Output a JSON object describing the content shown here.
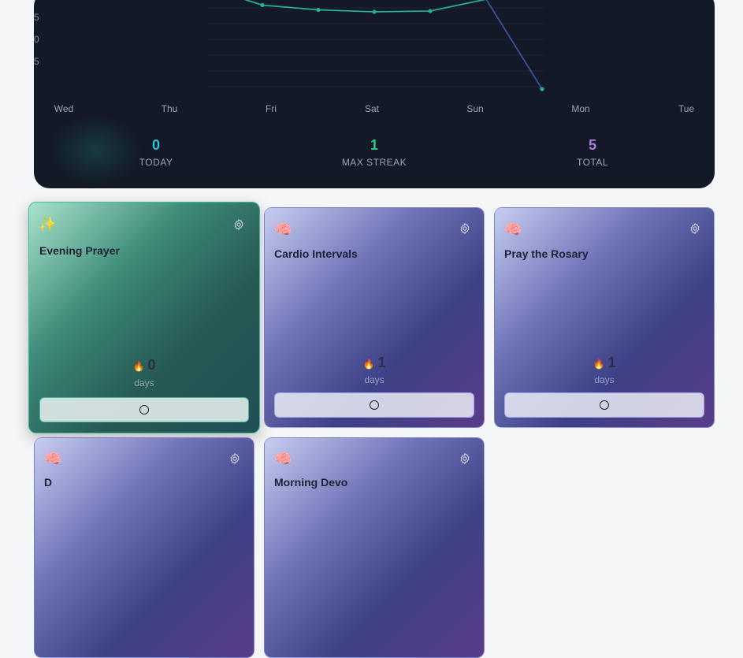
{
  "chart_data": {
    "type": "line",
    "categories": [
      "Wed",
      "Thu",
      "Fri",
      "Sat",
      "Sun",
      "Mon",
      "Tue"
    ],
    "y_tick_labels": [
      "5",
      "0",
      "5"
    ],
    "series": [
      {
        "color": "#23b08c",
        "points": [
          [
            "Thu",
            1.25
          ],
          [
            "Fri",
            1.21
          ],
          [
            "Sat",
            1.18
          ],
          [
            "Sun",
            1.19
          ],
          [
            "Mon",
            1.3
          ]
        ]
      },
      {
        "color": "#3b4fa0",
        "points": [
          [
            "Sun",
            1.3
          ],
          [
            "Mon",
            0.0
          ]
        ]
      }
    ],
    "grid": true
  },
  "stats": [
    {
      "value": "0",
      "label": "TODAY",
      "color": "#2bc4d6"
    },
    {
      "value": "1",
      "label": "MAX STREAK",
      "color": "#2ecf7a"
    },
    {
      "value": "5",
      "label": "TOTAL",
      "color": "#b07be0"
    }
  ],
  "cards": [
    {
      "emoji": "✨",
      "title": "Evening Prayer",
      "streak": "0",
      "days_label": "days",
      "selected": true
    },
    {
      "emoji": "🧠",
      "title": "Cardio Intervals",
      "streak": "1",
      "days_label": "days",
      "selected": false
    },
    {
      "emoji": "🧠",
      "title": "Pray the Rosary",
      "streak": "1",
      "days_label": "days",
      "selected": false
    },
    {
      "emoji": "🧠",
      "title": "D",
      "selected": false
    },
    {
      "emoji": "🧠",
      "title": "Morning Devo",
      "selected": false
    }
  ]
}
